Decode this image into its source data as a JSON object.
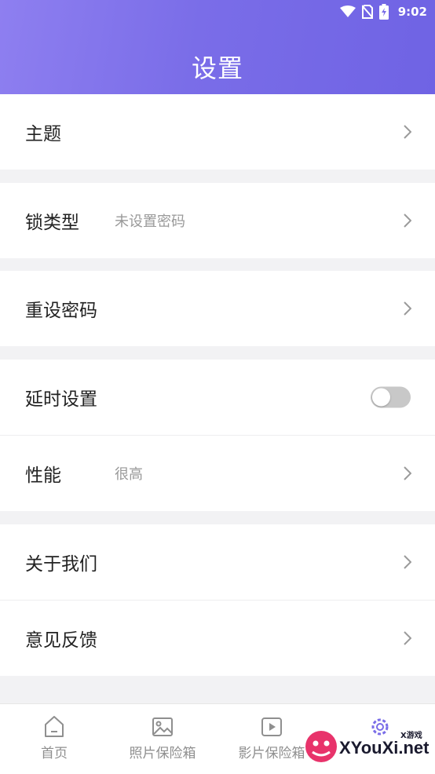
{
  "status_bar": {
    "time": "9:02",
    "icons": [
      "wifi-icon",
      "no-sim-icon",
      "battery-charging-icon"
    ]
  },
  "header": {
    "title": "设置"
  },
  "settings": {
    "theme": {
      "label": "主题"
    },
    "lock_type": {
      "label": "锁类型",
      "value": "未设置密码"
    },
    "reset_password": {
      "label": "重设密码"
    },
    "delay": {
      "label": "延时设置",
      "enabled": false
    },
    "performance": {
      "label": "性能",
      "value": "很高"
    },
    "about": {
      "label": "关于我们"
    },
    "feedback": {
      "label": "意见反馈"
    }
  },
  "bottom_nav": {
    "items": [
      {
        "label": "首页",
        "icon": "home-icon"
      },
      {
        "label": "照片保险箱",
        "icon": "image-icon"
      },
      {
        "label": "影片保险箱",
        "icon": "video-play-icon"
      },
      {
        "label": "",
        "icon": "gear-icon"
      }
    ]
  },
  "watermark": {
    "text": "XYouXi.net",
    "small": "X游戏"
  },
  "colors": {
    "header_gradient_start": "#8e7ff0",
    "header_gradient_end": "#6f63e4",
    "background": "#f2f2f4",
    "text_primary": "#222222",
    "text_secondary": "#999999",
    "nav_inactive": "#8f8f8f"
  }
}
